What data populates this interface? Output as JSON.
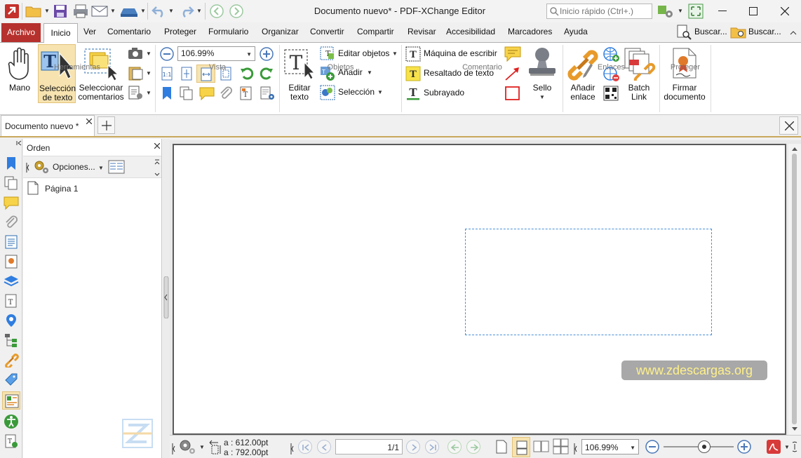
{
  "window": {
    "title": "Documento nuevo* - PDF-XChange Editor",
    "quick_search_placeholder": "Inicio rápido (Ctrl+.)"
  },
  "menu": {
    "archivo": "Archivo",
    "tabs": [
      "Inicio",
      "Ver",
      "Comentario",
      "Proteger",
      "Formulario",
      "Organizar",
      "Convertir",
      "Compartir",
      "Revisar",
      "Accesibilidad",
      "Marcadores",
      "Ayuda"
    ],
    "buscar1": "Buscar...",
    "buscar2": "Buscar..."
  },
  "ribbon": {
    "herramientas": {
      "group": "Herramientas",
      "mano": "Mano",
      "seleccion_texto": [
        "Selección",
        "de texto"
      ],
      "seleccionar_comentarios": [
        "Seleccionar",
        "comentarios"
      ]
    },
    "vista": {
      "group": "Vista",
      "zoom": "106.99%"
    },
    "objetos": {
      "group": "Objetos",
      "editar_texto": [
        "Editar",
        "texto"
      ],
      "editar_objetos": "Editar objetos",
      "anadir": "Añadir",
      "seleccion": "Selección"
    },
    "comentario": {
      "group": "Comentario",
      "maquina": "Máquina de escribir",
      "resaltado": "Resaltado de texto",
      "subrayado": "Subrayado",
      "sello": "Sello"
    },
    "enlaces": {
      "group": "Enlaces",
      "anadir_enlace": [
        "Añadir",
        "enlace"
      ],
      "batch_link": [
        "Batch",
        "Link"
      ]
    },
    "proteger": {
      "group": "Proteger",
      "firmar": [
        "Firmar",
        "documento"
      ]
    }
  },
  "doc_tab": {
    "label": "Documento nuevo *"
  },
  "panel": {
    "title": "Orden",
    "options": "Opciones...",
    "page_item": "Página 1"
  },
  "watermark": "www.zdescargas.org",
  "statusbar": {
    "width": "a : 612.00pt",
    "height": "a : 792.00pt",
    "page": "1/1",
    "zoom": "106.99%",
    "zoom_slider_fraction": 0.58
  },
  "colors": {
    "accent": "#b6312d",
    "selection": "#4a90d9",
    "active_tool": "#f6e3b0"
  }
}
